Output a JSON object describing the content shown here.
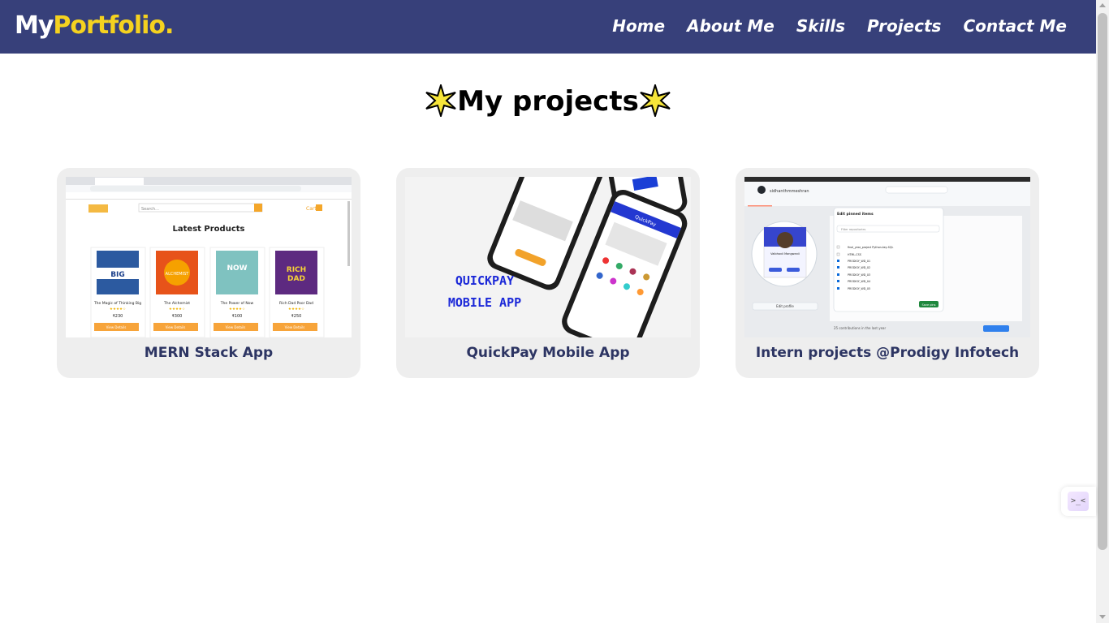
{
  "brand": {
    "part1": "My",
    "part2": "Portfolio."
  },
  "nav": {
    "items": [
      {
        "label": "Home"
      },
      {
        "label": "About Me"
      },
      {
        "label": "Skills"
      },
      {
        "label": "Projects"
      },
      {
        "label": "Contact Me"
      }
    ]
  },
  "page": {
    "heading": "My projects"
  },
  "projects": [
    {
      "title": "MERN Stack App",
      "preview": {
        "search_placeholder": "Search...",
        "cart_label": "Cart",
        "section_title": "Latest Products",
        "products": [
          {
            "name": "The Magic of Thinking Big",
            "price": "₹230",
            "cover_text": "MAGIC OF THINKING BIG"
          },
          {
            "name": "The Alchemist",
            "price": "₹300",
            "cover_text": "ALCHEMIST"
          },
          {
            "name": "The Power of Now",
            "price": "₹100",
            "cover_text": "THE POWER OF NOW"
          },
          {
            "name": "Rich Dad Poor Dad",
            "price": "₹250",
            "cover_text": "RICH DAD POOR DAD"
          }
        ],
        "button_label": "View Details"
      }
    },
    {
      "title": "QuickPay Mobile App",
      "preview": {
        "banner_line1": "QUICKPAY",
        "banner_line2": "MOBILE APP",
        "app_name": "QuickPay"
      }
    },
    {
      "title": "Intern projects @Prodigy Infotech",
      "preview": {
        "username": "sidhanthmmeshran",
        "profile_name": "Vaibhavii Mangwanii",
        "dialog_title": "Edit pinned items",
        "dialog_search": "Filter repositories",
        "repos": [
          "final_year_project Python-key-SQL",
          "HTML-CSS",
          "PRODIGY_WD_01",
          "PRODIGY_WD_02",
          "PRODIGY_WD_03",
          "PRODIGY_WD_04",
          "PRODIGY_WD_05"
        ],
        "save_button": "Save pins",
        "edit_button": "Edit profile",
        "contributions": "25 contributions in the last year"
      }
    }
  ],
  "colors": {
    "navbar": "#37407a",
    "accent": "#f5d21f",
    "card": "#eeeeee",
    "card_title": "#2d3563"
  },
  "icons": [
    "star-icon",
    "chat-widget-icon"
  ]
}
